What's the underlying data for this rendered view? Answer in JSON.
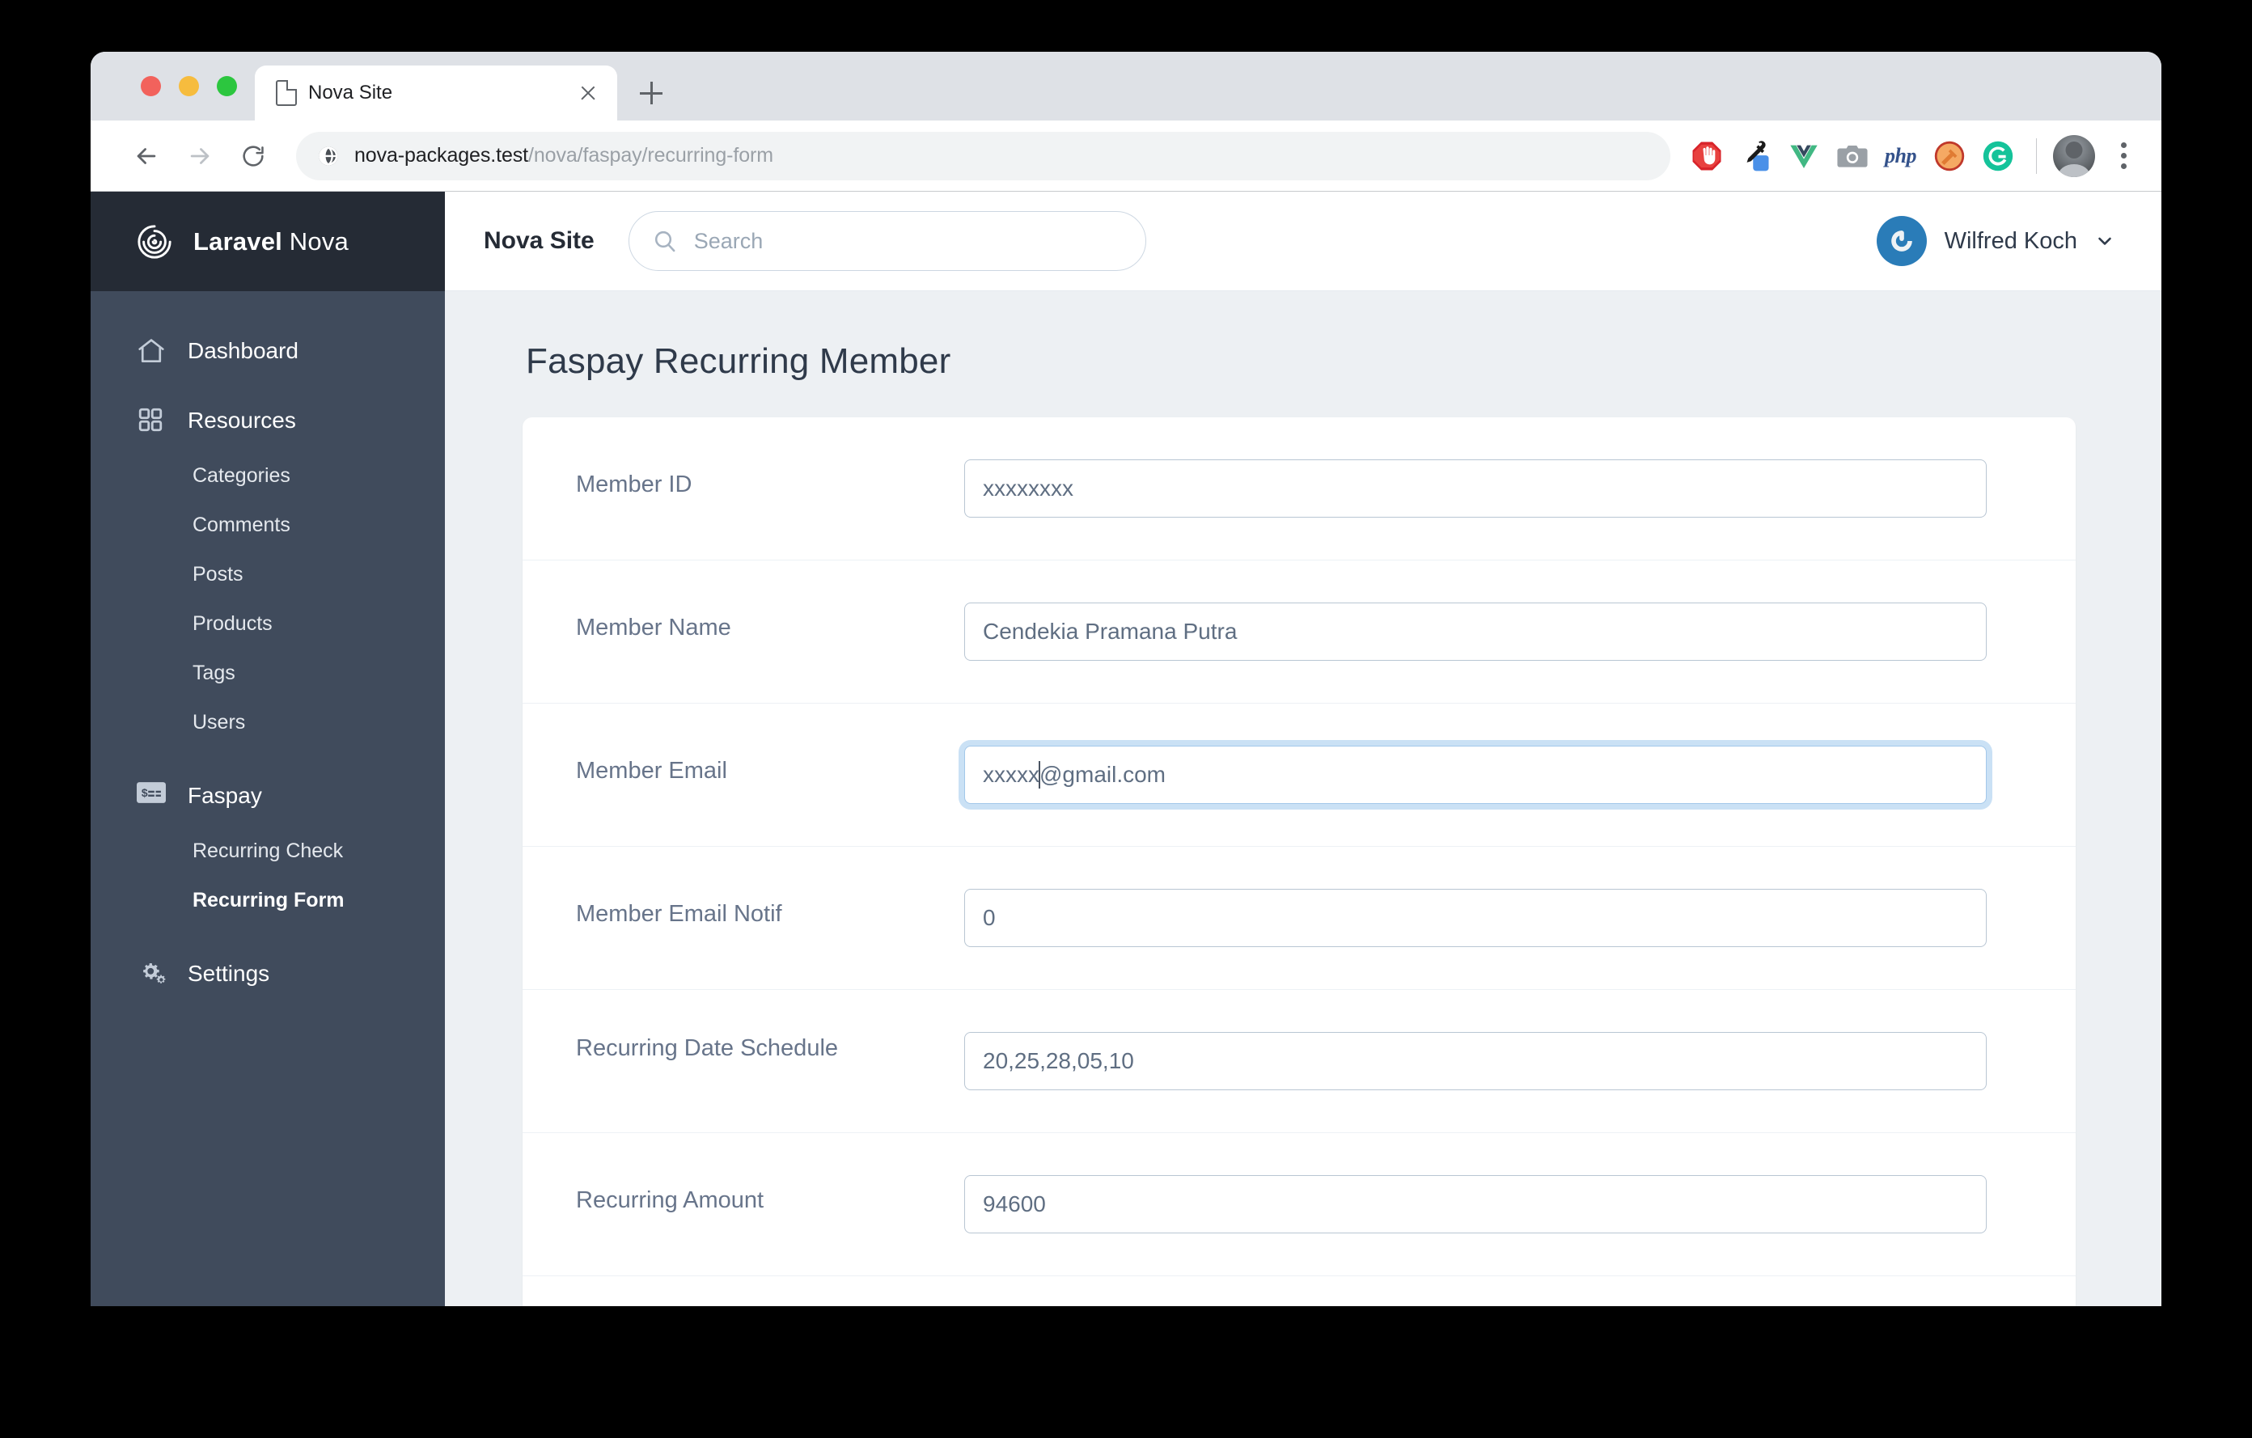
{
  "browser": {
    "tab": {
      "title": "Nova Site",
      "icon": "page-icon"
    },
    "new_tab_label": "+",
    "omnibox": {
      "host": "nova-packages.test",
      "path": "/nova/faspay/recurring-form",
      "full_url": "nova-packages.test/nova/faspay/recurring-form",
      "site_icon": "globe-icon"
    },
    "nav": {
      "back": "back-icon",
      "forward": "forward-icon",
      "reload": "reload-icon"
    },
    "extensions": [
      {
        "name": "adblock-icon",
        "title": "AdBlock"
      },
      {
        "name": "eyedropper-icon",
        "title": "ColorZilla"
      },
      {
        "name": "vue-devtools-icon",
        "title": "Vue.js devtools"
      },
      {
        "name": "screenshot-camera-icon",
        "title": "Screenshot"
      },
      {
        "name": "php-icon",
        "title": "php"
      },
      {
        "name": "hammer-icon",
        "title": "Telescope"
      },
      {
        "name": "grammarly-icon",
        "title": "Grammarly"
      }
    ],
    "profile_avatar": "user-avatar-photo",
    "menu": "kebab-menu-icon"
  },
  "nova": {
    "brand": {
      "bold": "Laravel",
      "light": " Nova",
      "logo": "nova-spiral-logo"
    },
    "sidebar": {
      "sections": [
        {
          "label": "Dashboard",
          "icon": "home-icon",
          "items": []
        },
        {
          "label": "Resources",
          "icon": "grid-icon",
          "items": [
            {
              "label": "Categories",
              "active": false
            },
            {
              "label": "Comments",
              "active": false
            },
            {
              "label": "Posts",
              "active": false
            },
            {
              "label": "Products",
              "active": false
            },
            {
              "label": "Tags",
              "active": false
            },
            {
              "label": "Users",
              "active": false
            }
          ]
        },
        {
          "label": "Faspay",
          "icon": "credit-card-icon",
          "items": [
            {
              "label": "Recurring Check",
              "active": false
            },
            {
              "label": "Recurring Form",
              "active": true
            }
          ]
        },
        {
          "label": "Settings",
          "icon": "gears-icon",
          "items": []
        }
      ]
    },
    "topbar": {
      "site_name": "Nova Site",
      "search_placeholder": "Search",
      "search_value": "",
      "search_icon": "search-icon",
      "user_name": "Wilfred Koch",
      "user_avatar": "power-button-avatar",
      "chevron": "chevron-down-icon"
    },
    "page": {
      "title": "Faspay Recurring Member",
      "fields": [
        {
          "label": "Member ID",
          "value": "xxxxxxxx",
          "focused": false
        },
        {
          "label": "Member Name",
          "value": "Cendekia Pramana Putra",
          "focused": false
        },
        {
          "label": "Member Email",
          "value": "xxxxx@gmail.com",
          "focused": true,
          "caret_after": 5
        },
        {
          "label": "Member Email Notif",
          "value": "0",
          "focused": false
        },
        {
          "label": "Recurring Date Schedule",
          "value": "20,25,28,05,10",
          "focused": false
        },
        {
          "label": "Recurring Amount",
          "value": "94600",
          "focused": false
        }
      ]
    }
  },
  "colors": {
    "sidebar_dark": "#252b35",
    "sidebar_body": "#404b5c",
    "content_bg": "#edf0f3",
    "input_border": "#b9c6d3",
    "focus_ring": "#74afe5",
    "accent_blue": "#2a7cb8",
    "label_text": "#67748a"
  }
}
